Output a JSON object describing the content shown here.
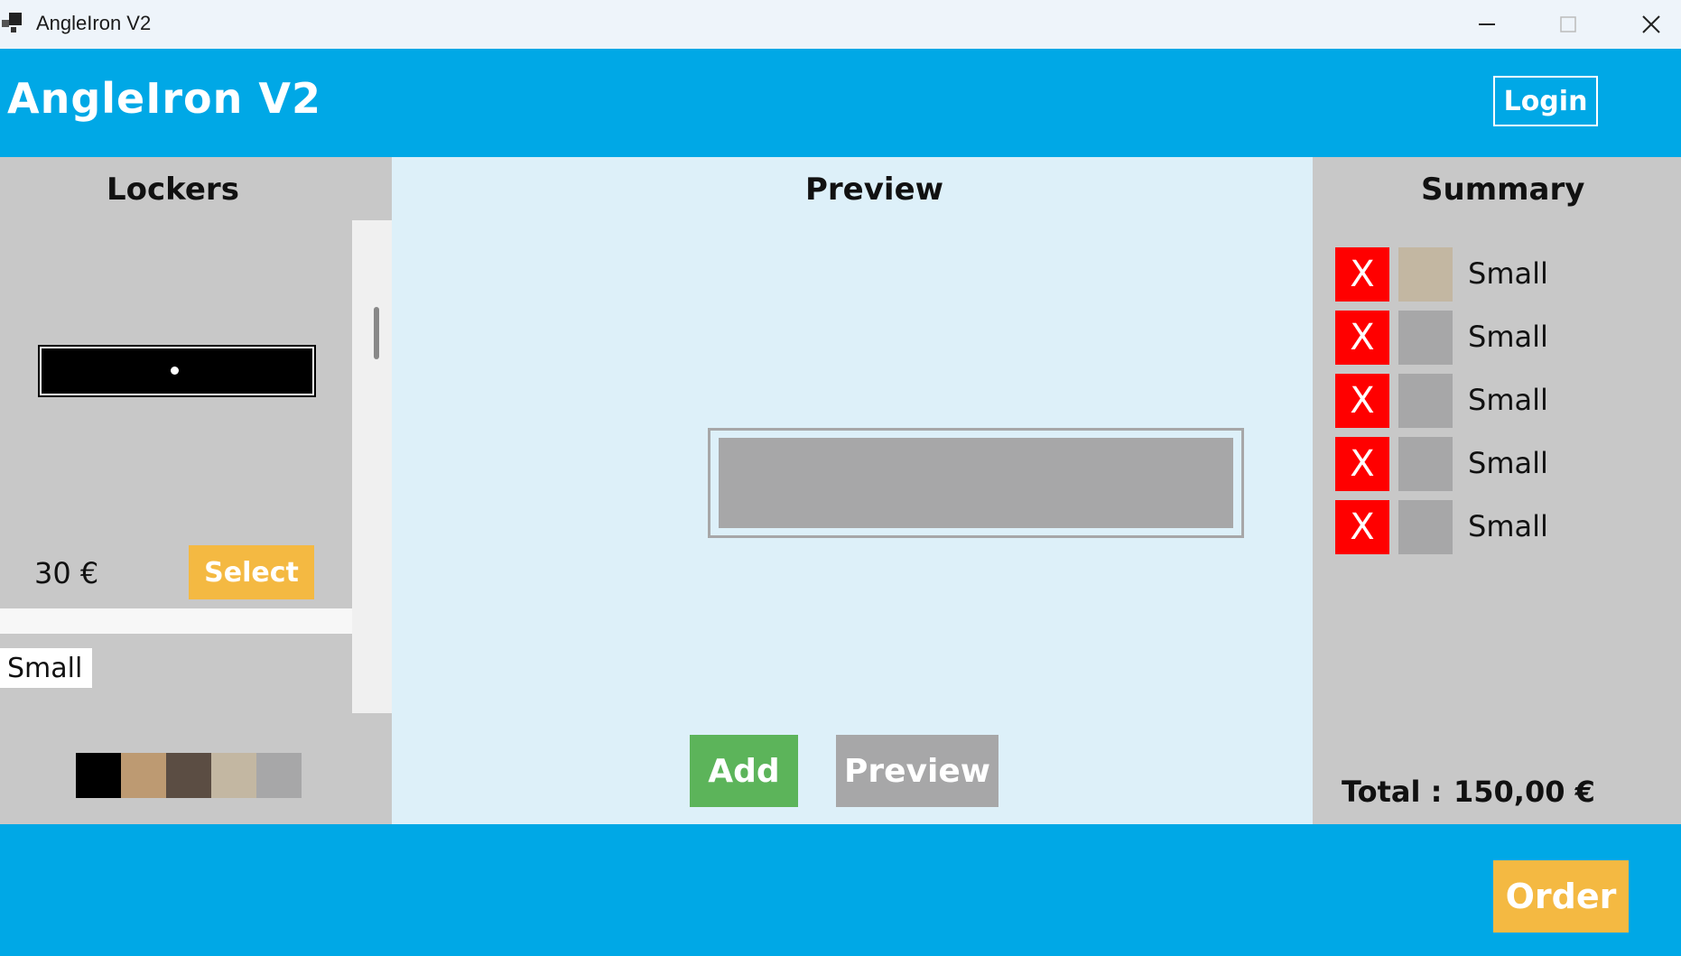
{
  "window": {
    "title": "AngleIron V2",
    "icon": "app-icon",
    "controls": {
      "minimize": "—",
      "maximize": "☐",
      "close": "✕"
    }
  },
  "header": {
    "app_title": "AngleIron V2",
    "login_label": "Login"
  },
  "lockers": {
    "title": "Lockers",
    "item": {
      "price": "30 €",
      "select_label": "Select"
    },
    "next_item": {
      "size_label": "Small"
    },
    "colors": [
      "#000000",
      "#bd9a72",
      "#5b4d43",
      "#c3b7a2",
      "#a7a7a8"
    ]
  },
  "preview": {
    "title": "Preview",
    "locker_color": "#a7a7a8",
    "add_label": "Add",
    "preview_label": "Preview"
  },
  "summary": {
    "title": "Summary",
    "remove_symbol": "X",
    "items": [
      {
        "label": "Small",
        "color": "#c3b7a2"
      },
      {
        "label": "Small",
        "color": "#a7a7a8"
      },
      {
        "label": "Small",
        "color": "#a7a7a8"
      },
      {
        "label": "Small",
        "color": "#a7a7a8"
      },
      {
        "label": "Small",
        "color": "#a7a7a8"
      }
    ],
    "total_label": "Total  :",
    "total_value": "150,00 €"
  },
  "footer": {
    "order_label": "Order"
  }
}
